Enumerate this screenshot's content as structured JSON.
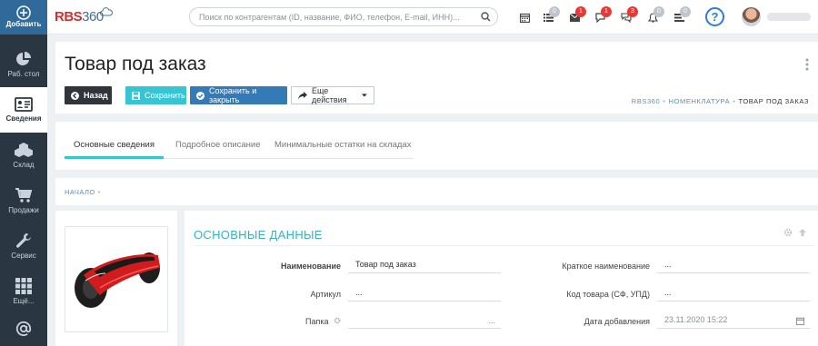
{
  "sidebar": {
    "add_label": "Добавить",
    "items": [
      {
        "label": "Раб. стол",
        "icon": "pie-chart-icon"
      },
      {
        "label": "Сведения",
        "icon": "id-card-icon"
      },
      {
        "label": "Склад",
        "icon": "cubes-icon"
      },
      {
        "label": "Продажи",
        "icon": "cart-icon"
      },
      {
        "label": "Сервис",
        "icon": "wrench-icon"
      },
      {
        "label": "Ещё...",
        "icon": "grid-icon"
      }
    ],
    "bottom_icon": "at-sign-icon"
  },
  "topbar": {
    "logo_part1": "RBS",
    "logo_part2": "360",
    "search_placeholder": "Поиск по контрагентам (ID, название, ФИО, телефон, E-mail, ИНН)...",
    "badges": [
      "0",
      "1",
      "1",
      "3",
      "0",
      "0"
    ],
    "help_label": "?"
  },
  "header": {
    "title": "Товар под заказ",
    "buttons": {
      "back": "Назад",
      "save": "Сохранить",
      "save_close": "Сохранить и закрыть",
      "more": "Еще действия"
    },
    "breadcrumb": [
      "RBS360",
      "НОМЕНКЛАТУРА",
      "ТОВАР ПОД ЗАКАЗ"
    ]
  },
  "tabs": [
    "Основные сведения",
    "Подробное описание",
    "Минимальные остатки на складах"
  ],
  "sub_breadcrumb": "НАЧАЛО",
  "details": {
    "section_title": "ОСНОВНЫЕ ДАННЫЕ",
    "fields": {
      "name_label": "Наименование",
      "name_value": "Товар под заказ",
      "article_label": "Артикул",
      "article_value": "...",
      "folder_label": "Папка",
      "folder_value": "...",
      "short_name_label": "Краткое наименование",
      "short_name_value": "...",
      "code_label": "Код товара (СФ, УПД)",
      "code_value": "...",
      "date_label": "Дата добавления",
      "date_value": "23.11.2020 15:22"
    }
  },
  "colors": {
    "sidebar_bg": "#2b3643",
    "accent": "#36c6d3",
    "primary": "#337ab7",
    "badge_red": "#e53935"
  }
}
